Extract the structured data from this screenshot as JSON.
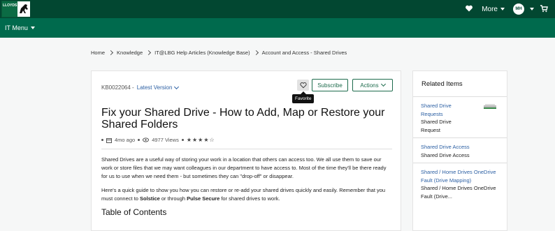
{
  "header": {
    "logo_text": "LLOYDS",
    "more_label": "More",
    "avatar_initials": "MH"
  },
  "menu": {
    "it_menu_label": "IT Menu"
  },
  "breadcrumb": [
    "Home",
    "Knowledge",
    "IT@LBG Help Articles (Knowledge Base)",
    "Account and Access - Shared Drives"
  ],
  "article": {
    "kb_number": "KB0022064 -",
    "version_label": "Latest Version",
    "favorite_tooltip": "Favorite",
    "subscribe_label": "Subscribe",
    "actions_label": "Actions",
    "title": "Fix your Shared Drive - How to Add, Map or Restore your Shared Folders",
    "age": "4mo ago",
    "views": "4977 Views",
    "rating": "★★★★☆",
    "para1": "Shared Drives are a useful way of storing your work in a location that others can access too. We all use them to save our work or store files that we may want colleagues in our department to have access to. Most of the time they'll be there ready for us to use when we need them - but sometimes they can \"drop-off\" or disappear.",
    "para2_a": "Here's a quick guide to show you how you can restore or re-add your shared drives quickly and easily. Remember that you must connect to ",
    "para2_b": "Solstice",
    "para2_c": " or through ",
    "para2_d": "Pulse Secure",
    "para2_e": " for shared drives to work.",
    "toc_heading": "Table of Contents"
  },
  "related": {
    "heading": "Related Items",
    "items": [
      {
        "link": "Shared Drive Requests",
        "desc": "Shared Drive Request"
      },
      {
        "link": "Shared Drive Access",
        "desc": "Shared Drive Access"
      },
      {
        "link": "Shared / Home Drives OneDrive Fault (Drive Mapping)",
        "desc": "Shared / Home Drives OneDrive Fault (Drive..."
      }
    ]
  },
  "colors": {
    "header_bg": "#024731",
    "menu_bg": "#006a4d",
    "link": "#2b5fa3",
    "button": "#1d6b4c"
  }
}
